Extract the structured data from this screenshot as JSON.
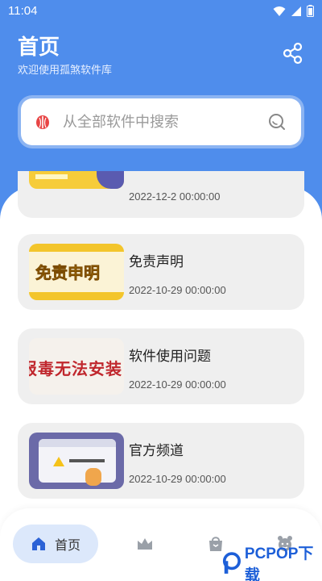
{
  "status_bar": {
    "time": "11:04"
  },
  "header": {
    "title": "首页",
    "subtitle": "欢迎使用孤煞软件库"
  },
  "search": {
    "placeholder": "从全部软件中搜索"
  },
  "articles": [
    {
      "title": "",
      "date": "2022-12-2 00:00:00"
    },
    {
      "title": "免责声明",
      "date": "2022-10-29 00:00:00",
      "thumb_text": "免责申明"
    },
    {
      "title": "软件使用问题",
      "date": "2022-10-29 00:00:00",
      "thumb_text": "报毒无法安装"
    },
    {
      "title": "官方频道",
      "date": "2022-10-29 00:00:00"
    }
  ],
  "bottom_nav": {
    "home_label": "首页",
    "icons": [
      "home-icon",
      "crown-icon",
      "bag-icon",
      "avatar-icon"
    ]
  },
  "watermark": {
    "text": "PCPOP下载"
  },
  "colors": {
    "primary": "#4f8dec",
    "card_bg": "#efefef",
    "nav_active_bg": "#dce8fb",
    "icon_blue": "#1d5fd8"
  }
}
